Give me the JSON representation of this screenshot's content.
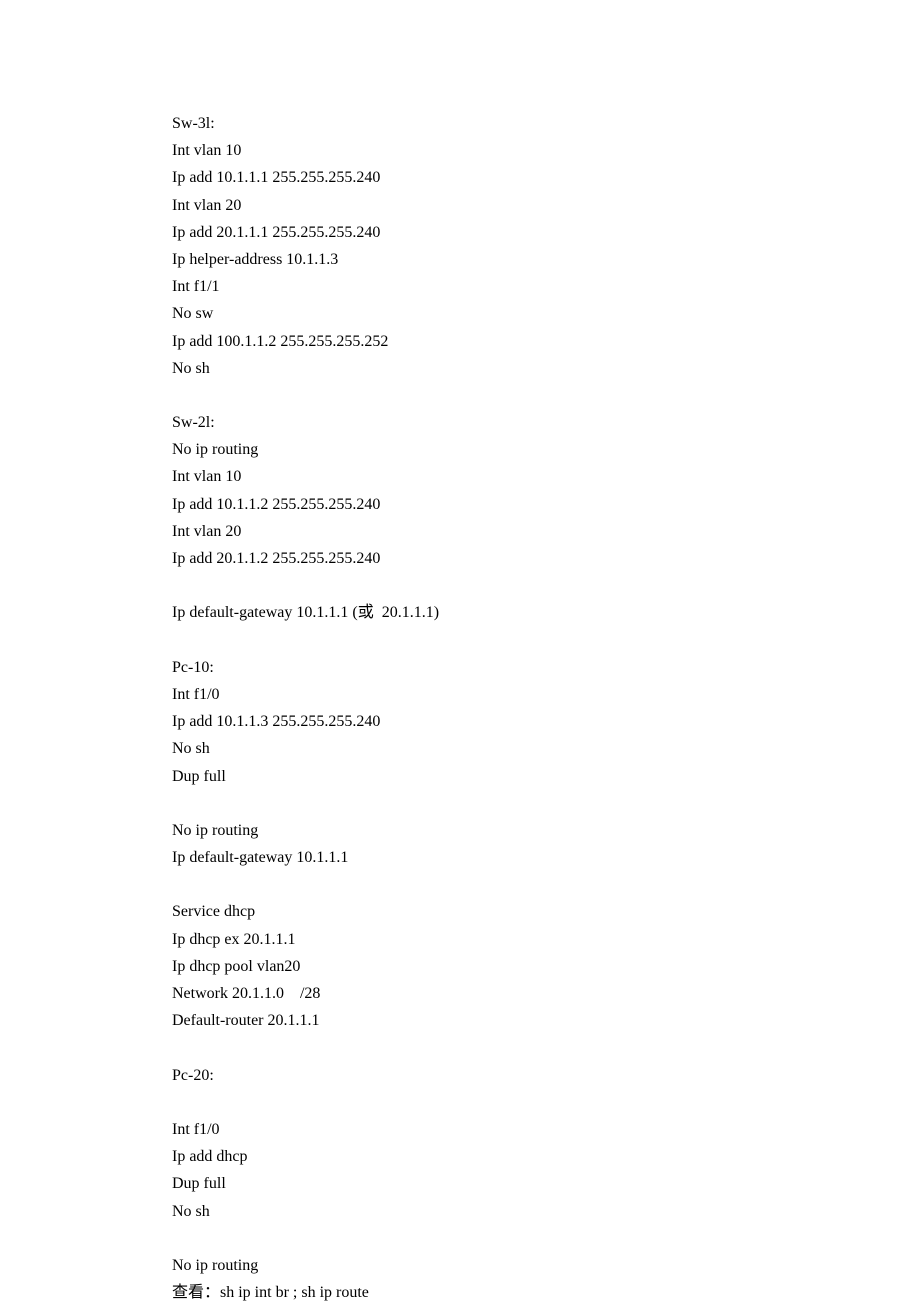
{
  "lines": [
    "Sw-3l:",
    "Int vlan 10",
    "Ip add 10.1.1.1 255.255.255.240",
    "Int vlan 20",
    "Ip add 20.1.1.1 255.255.255.240",
    "Ip helper-address 10.1.1.3",
    "Int f1/1",
    "No sw",
    "Ip add 100.1.1.2 255.255.255.252",
    "No sh",
    "",
    "Sw-2l:",
    "No ip routing",
    "Int vlan 10",
    "Ip add 10.1.1.2 255.255.255.240",
    "Int vlan 20",
    "Ip add 20.1.1.2 255.255.255.240",
    "",
    "Ip default-gateway 10.1.1.1 (或  20.1.1.1)",
    "",
    "Pc-10:",
    "Int f1/0",
    "Ip add 10.1.1.3 255.255.255.240",
    "No sh",
    "Dup full",
    "",
    "No ip routing",
    "Ip default-gateway 10.1.1.1",
    "",
    "Service dhcp",
    "Ip dhcp ex 20.1.1.1",
    "Ip dhcp pool vlan20",
    "Network 20.1.1.0    /28",
    "Default-router 20.1.1.1",
    "",
    "Pc-20:",
    "",
    "Int f1/0",
    "Ip add dhcp",
    "Dup full",
    "No sh",
    "",
    "No ip routing",
    "查看：sh ip int br ; sh ip route"
  ]
}
